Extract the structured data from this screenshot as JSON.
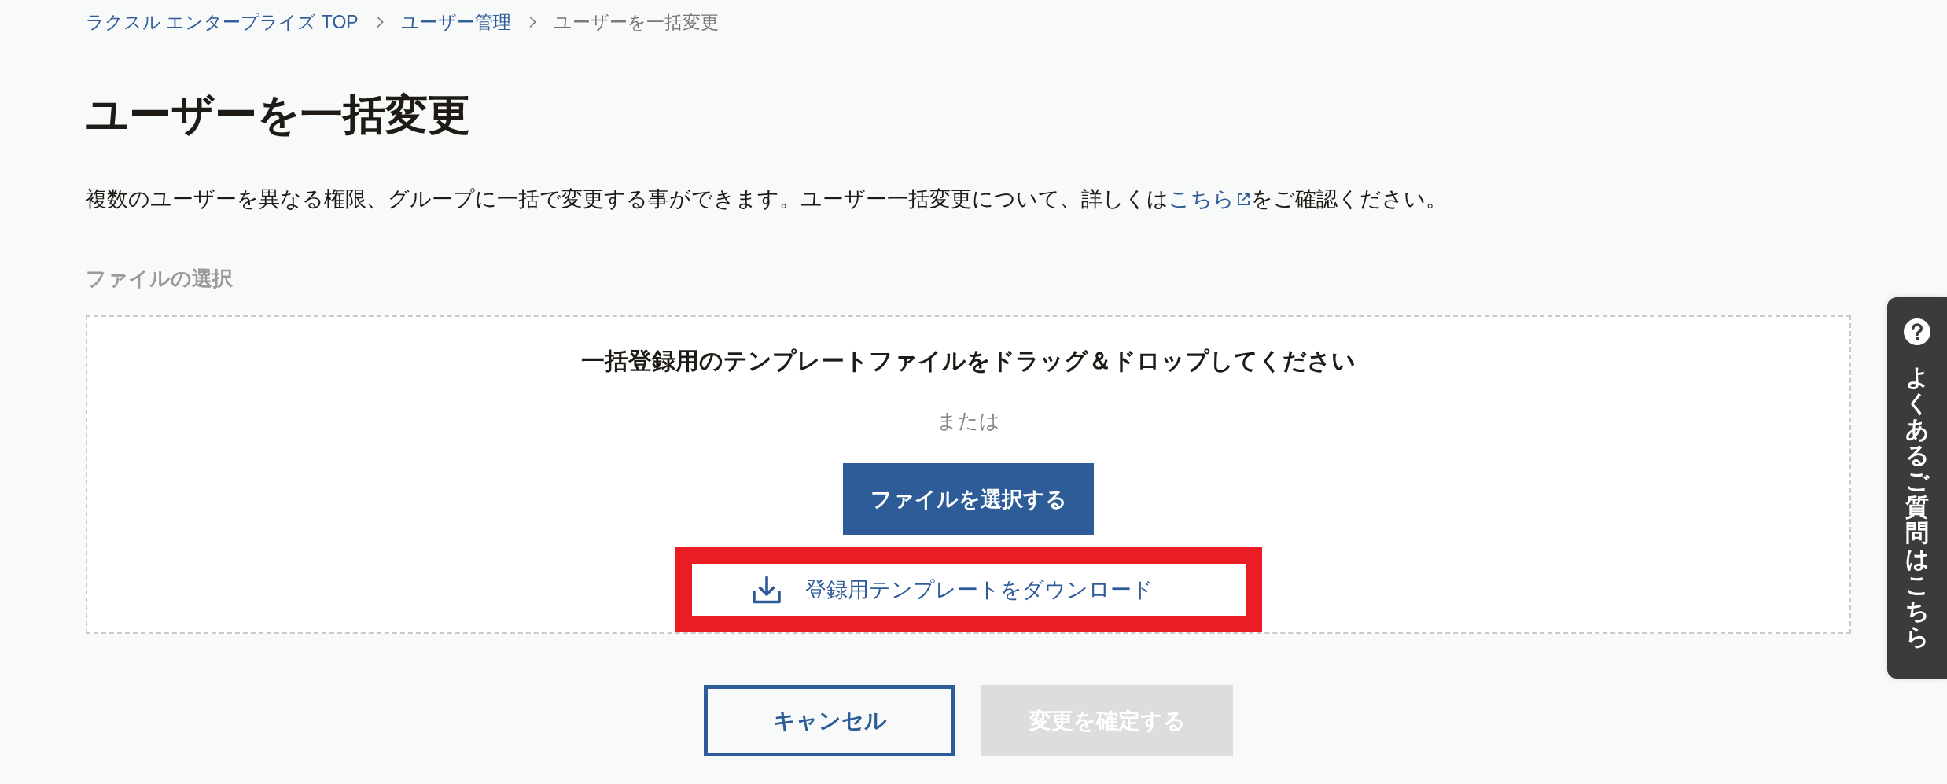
{
  "breadcrumb": [
    {
      "label": "ラクスル エンタープライズ TOP",
      "current": false
    },
    {
      "label": "ユーザー管理",
      "current": false
    },
    {
      "label": "ユーザーを一括変更",
      "current": true
    }
  ],
  "title": "ユーザーを一括変更",
  "description": {
    "before": "複数のユーザーを異なる権限、グループに一括で変更する事ができます。ユーザー一括変更について、詳しくは",
    "link": "こちら",
    "after": "をご確認ください。"
  },
  "file_section": {
    "label": "ファイルの選択",
    "dropzone": {
      "heading": "一括登録用のテンプレートファイルをドラッグ＆ドロップしてください",
      "separator": "または",
      "select_button": "ファイルを選択する",
      "download_link": {
        "label": "登録用テンプレートをダウンロード",
        "highlighted": true
      }
    }
  },
  "actions": [
    {
      "label": "キャンセル",
      "kind": "outline",
      "disabled": false
    },
    {
      "label": "変更を確定する",
      "kind": "primary",
      "disabled": true
    }
  ],
  "faq_tab": {
    "label": "よくあるご質問はこちら"
  }
}
